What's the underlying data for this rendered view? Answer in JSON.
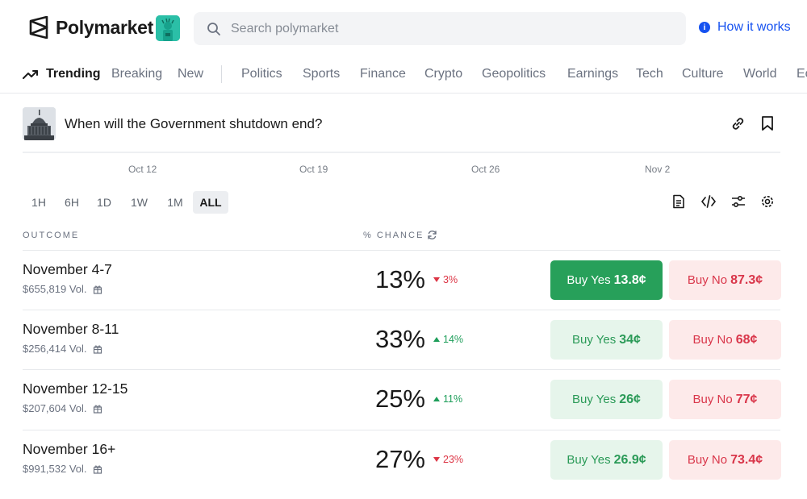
{
  "brand": {
    "name": "Polymarket"
  },
  "search": {
    "placeholder": "Search polymarket"
  },
  "help": {
    "label": "How it works",
    "icon": "info-icon"
  },
  "nav": {
    "items": [
      {
        "label": "Trending",
        "active": true
      },
      {
        "label": "Breaking"
      },
      {
        "label": "New"
      },
      {
        "label": "Politics"
      },
      {
        "label": "Sports"
      },
      {
        "label": "Finance"
      },
      {
        "label": "Crypto"
      },
      {
        "label": "Geopolitics"
      },
      {
        "label": "Earnings"
      },
      {
        "label": "Tech"
      },
      {
        "label": "Culture"
      },
      {
        "label": "World"
      },
      {
        "label": "Ec"
      }
    ]
  },
  "market": {
    "title": "When will the Government shutdown end?"
  },
  "chart": {
    "dates": [
      "Oct 12",
      "Oct 19",
      "Oct 26",
      "Nov 2"
    ]
  },
  "ranges": [
    "1H",
    "6H",
    "1D",
    "1W",
    "1M",
    "ALL"
  ],
  "active_range": "ALL",
  "table": {
    "outcome_header": "OUTCOME",
    "chance_header": "% CHANCE",
    "rows": [
      {
        "name": "November 4-7",
        "volume": "$655,819 Vol.",
        "chance": "13%",
        "delta": "3%",
        "direction": "down",
        "yes_label": "Buy Yes",
        "yes_price": "13.8¢",
        "no_label": "Buy No",
        "no_price": "87.3¢"
      },
      {
        "name": "November 8-11",
        "volume": "$256,414 Vol.",
        "chance": "33%",
        "delta": "14%",
        "direction": "up",
        "yes_label": "Buy Yes",
        "yes_price": "34¢",
        "no_label": "Buy No",
        "no_price": "68¢"
      },
      {
        "name": "November 12-15",
        "volume": "$207,604 Vol.",
        "chance": "25%",
        "delta": "11%",
        "direction": "up",
        "yes_label": "Buy Yes",
        "yes_price": "26¢",
        "no_label": "Buy No",
        "no_price": "77¢"
      },
      {
        "name": "November 16+",
        "volume": "$991,532 Vol.",
        "chance": "27%",
        "delta": "23%",
        "direction": "down",
        "yes_label": "Buy Yes",
        "yes_price": "26.9¢",
        "no_label": "Buy No",
        "no_price": "73.4¢"
      }
    ]
  },
  "colors": {
    "accent_blue": "#1652f0",
    "yes_green": "#27a05a",
    "no_red": "#d9364a"
  }
}
